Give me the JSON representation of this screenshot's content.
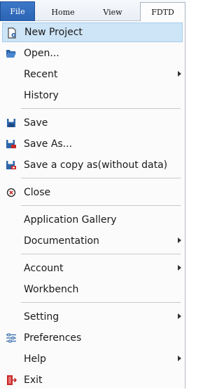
{
  "tabs": {
    "file": "File",
    "home": "Home",
    "view": "View",
    "fdtd": "FDTD"
  },
  "menu": {
    "new_project": "New Project",
    "open": "Open...",
    "recent": "Recent",
    "history": "History",
    "save": "Save",
    "save_as": "Save As...",
    "save_copy": "Save a copy as(without data)",
    "close": "Close",
    "application_gallery": "Application Gallery",
    "documentation": "Documentation",
    "account": "Account",
    "workbench": "Workbench",
    "setting": "Setting",
    "preferences": "Preferences",
    "help": "Help",
    "exit": "Exit"
  },
  "colors": {
    "file_tab": "#2a63b2",
    "highlight": "#cde5f7",
    "icon_blue": "#2d65a8",
    "icon_red": "#c62828"
  }
}
